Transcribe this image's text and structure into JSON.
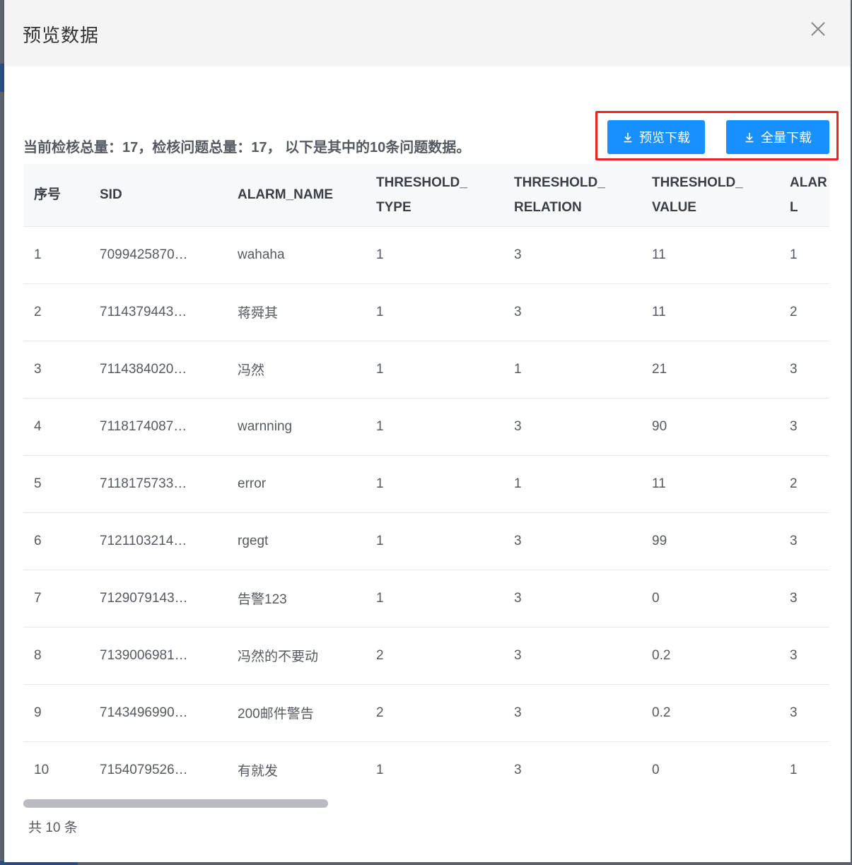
{
  "modal": {
    "title": "预览数据",
    "summary": "当前检核总量：17，检核问题总量：17， 以下是其中的10条问题数据。",
    "buttons": {
      "preview_download": "预览下载",
      "full_download": "全量下载"
    },
    "total": "共 10 条"
  },
  "colors": {
    "primary": "#1890ff",
    "highlight": "#ee2222"
  },
  "table": {
    "headers": [
      "序号",
      "SID",
      "ALARM_NAME",
      "THRESHOLD_\nTYPE",
      "THRESHOLD_\nRELATION",
      "THRESHOLD_\nVALUE",
      "ALAR\nL"
    ],
    "rows": [
      [
        "1",
        "7099425870…",
        "wahaha",
        "1",
        "3",
        "11",
        "1"
      ],
      [
        "2",
        "7114379443…",
        "蒋舜其",
        "1",
        "3",
        "11",
        "2"
      ],
      [
        "3",
        "7114384020…",
        "冯然",
        "1",
        "1",
        "21",
        "3"
      ],
      [
        "4",
        "7118174087…",
        "warnning",
        "1",
        "3",
        "90",
        "3"
      ],
      [
        "5",
        "7118175733…",
        "error",
        "1",
        "1",
        "11",
        "2"
      ],
      [
        "6",
        "7121103214…",
        "rgegt",
        "1",
        "3",
        "99",
        "3"
      ],
      [
        "7",
        "7129079143…",
        "告警123",
        "1",
        "3",
        "0",
        "3"
      ],
      [
        "8",
        "7139006981…",
        "冯然的不要动",
        "2",
        "3",
        "0.2",
        "3"
      ],
      [
        "9",
        "7143496990…",
        "200邮件警告",
        "2",
        "3",
        "0.2",
        "3"
      ],
      [
        "10",
        "7154079526…",
        "有就发",
        "1",
        "3",
        "0",
        "1"
      ]
    ]
  }
}
